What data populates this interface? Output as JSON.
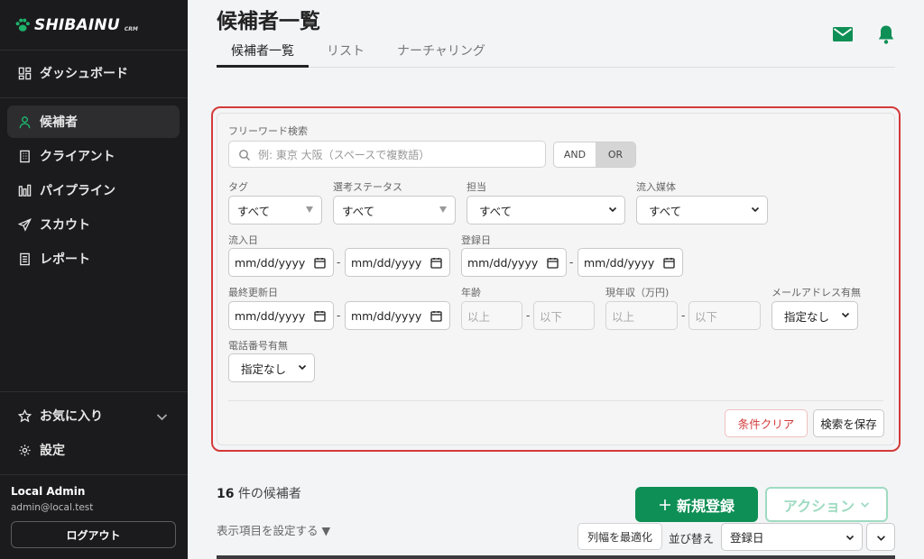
{
  "brand": {
    "name": "SHIBAINU",
    "sub": "CRM"
  },
  "sidebar": {
    "items": [
      {
        "label": "ダッシュボード",
        "icon": "dashboard-icon"
      },
      {
        "label": "候補者",
        "icon": "person-icon",
        "active": true
      },
      {
        "label": "クライアント",
        "icon": "building-icon"
      },
      {
        "label": "パイプライン",
        "icon": "bar-chart-icon"
      },
      {
        "label": "スカウト",
        "icon": "send-icon"
      },
      {
        "label": "レポート",
        "icon": "report-icon"
      }
    ],
    "favorites": "お気に入り",
    "settings": "設定",
    "user": {
      "name": "Local Admin",
      "email": "admin@local.test"
    },
    "logout": "ログアウト"
  },
  "header": {
    "title": "候補者一覧",
    "tabs": [
      "候補者一覧",
      "リスト",
      "ナーチャリング"
    ]
  },
  "filters": {
    "freeword_label": "フリーワード検索",
    "freeword_placeholder": "例: 東京 大阪（スペースで複数語）",
    "and_label": "AND",
    "or_label": "OR",
    "tag_label": "タグ",
    "tag_value": "すべて",
    "status_label": "選考ステータス",
    "status_value": "すべて",
    "owner_label": "担当",
    "owner_value": "すべて",
    "source_label": "流入媒体",
    "source_value": "すべて",
    "inflow_date_label": "流入日",
    "reg_date_label": "登録日",
    "updated_label": "最終更新日",
    "date_placeholder": "mm/dd/yyyy",
    "dash": "-",
    "age_label": "年齢",
    "income_label": "現年収（万円)",
    "min_placeholder": "以上",
    "max_placeholder": "以下",
    "email_label": "メールアドレス有無",
    "email_value": "指定なし",
    "phone_label": "電話番号有無",
    "phone_value": "指定なし",
    "clear_button": "条件クリア",
    "save_button": "検索を保存"
  },
  "results": {
    "count": "16",
    "count_suffix": " 件の候補者",
    "new_button": "新規登録",
    "action_button": "アクション",
    "column_setting": "表示項目を設定する ▼",
    "fit_button": "列幅を最適化",
    "sort_label": "並び替え",
    "sort_value": "登録日"
  },
  "colors": {
    "accent": "#0e8f55",
    "highlight": "#d43a3a",
    "sidebar": "#1b1b1d"
  }
}
